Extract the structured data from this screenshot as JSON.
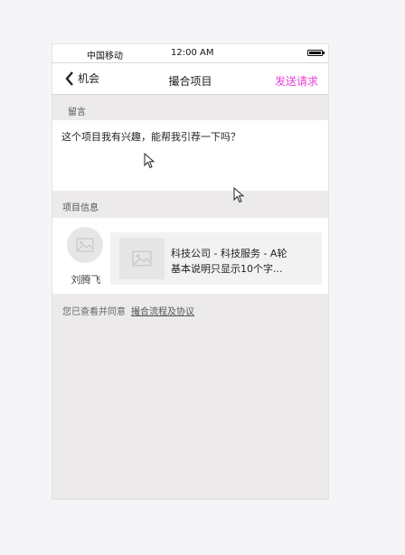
{
  "status_bar": {
    "carrier": "中国移动",
    "time": "12:00 AM"
  },
  "nav": {
    "back_label": "机会",
    "title": "撮合项目",
    "action_label": "发送请求",
    "action_color": "#e83fd6"
  },
  "message_section": {
    "label": "留言",
    "text": "这个项目我有兴趣，能帮我引荐一下吗？"
  },
  "info_section": {
    "label": "项目信息",
    "person_name": "刘腾飞",
    "card_line1": "科技公司 - 科技服务 - A轮",
    "card_line2": "基本说明只显示10个字..."
  },
  "agreement": {
    "prefix": "您已查看并同意",
    "link": "撮合流程及协议"
  },
  "icons": [
    "chevron-left-icon",
    "image-placeholder-icon",
    "battery-icon",
    "mouse-cursor-icon"
  ]
}
